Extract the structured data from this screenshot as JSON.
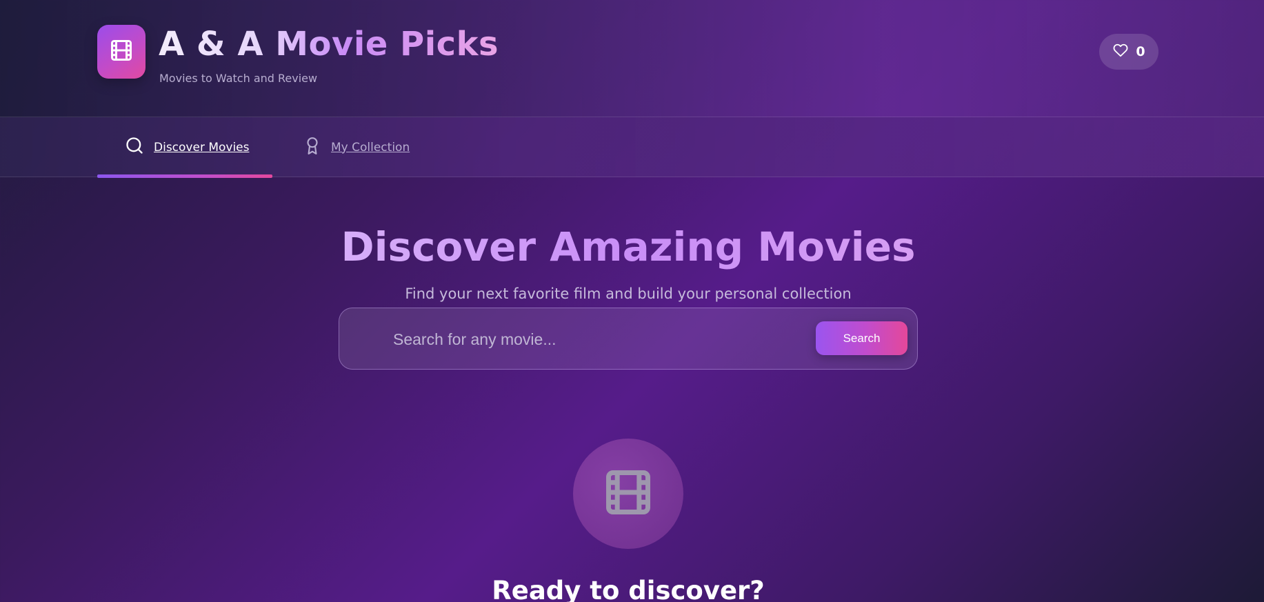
{
  "header": {
    "title": "A & A Movie Picks",
    "subtitle": "Movies to Watch and Review",
    "logo_icon": "film-icon",
    "favorites": {
      "icon": "heart-icon",
      "count": "0"
    }
  },
  "nav": {
    "tabs": [
      {
        "label": "Discover Movies",
        "icon": "search-icon",
        "active": true
      },
      {
        "label": "My Collection",
        "icon": "award-icon",
        "active": false
      }
    ]
  },
  "hero": {
    "title": "Discover Amazing Movies",
    "subtitle": "Find your next favorite film and build your personal collection"
  },
  "search": {
    "placeholder": "Search for any movie...",
    "value": "",
    "button_label": "Search"
  },
  "empty_state": {
    "icon": "film-icon",
    "title": "Ready to discover?"
  },
  "colors": {
    "accent_start": "#9b55ef",
    "accent_end": "#e4489a",
    "background": "#561c8a"
  }
}
